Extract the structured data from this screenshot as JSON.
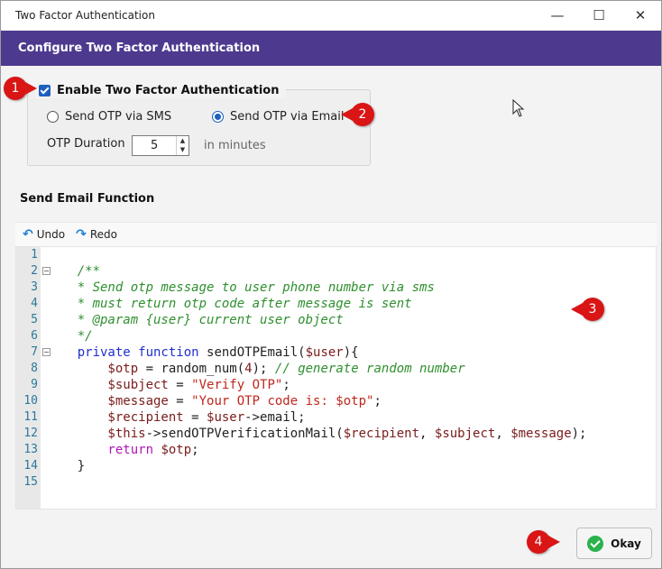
{
  "window": {
    "title": "Two Factor Authentication",
    "controls": {
      "minimize": "—",
      "maximize": "☐",
      "close": "✕"
    }
  },
  "banner": {
    "title": "Configure Two Factor Authentication"
  },
  "settings": {
    "enable_label": "Enable Two Factor Authentication",
    "enable_checked": true,
    "sms_label": "Send OTP via SMS",
    "email_label": "Send OTP via Email",
    "selected": "email",
    "otp_duration_label": "OTP Duration",
    "otp_duration_value": "5",
    "otp_duration_unit": "in minutes"
  },
  "section_title": "Send Email Function",
  "toolbar": {
    "undo_label": "Undo",
    "redo_label": "Redo"
  },
  "editor": {
    "line_numbers": [
      "1",
      "2",
      "3",
      "4",
      "5",
      "6",
      "7",
      "8",
      "9",
      "10",
      "11",
      "12",
      "13",
      "14",
      "15"
    ],
    "lines": [
      {
        "parts": []
      },
      {
        "parts": [
          [
            "cm",
            "    /**"
          ]
        ]
      },
      {
        "parts": [
          [
            "cm",
            "    * Send otp message to user phone number via sms"
          ]
        ]
      },
      {
        "parts": [
          [
            "cm",
            "    * must return otp code after message is sent"
          ]
        ]
      },
      {
        "parts": [
          [
            "cm",
            "    * @param {user} current user object"
          ]
        ]
      },
      {
        "parts": [
          [
            "cm",
            "    */"
          ]
        ]
      },
      {
        "parts": [
          [
            "kw",
            "    private function "
          ],
          [
            "pl",
            "sendOTPEmail("
          ],
          [
            "var",
            "$user"
          ],
          [
            "pl",
            "){"
          ]
        ]
      },
      {
        "parts": [
          [
            "var",
            "        $otp"
          ],
          [
            "pl",
            " = random_num("
          ],
          [
            "var",
            "4"
          ],
          [
            "pl",
            "); "
          ],
          [
            "cm",
            "// generate random number"
          ]
        ]
      },
      {
        "parts": [
          [
            "var",
            "        $subject"
          ],
          [
            "pl",
            " = "
          ],
          [
            "str",
            "\"Verify OTP\""
          ],
          [
            "pl",
            ";"
          ]
        ]
      },
      {
        "parts": [
          [
            "var",
            "        $message"
          ],
          [
            "pl",
            " = "
          ],
          [
            "str",
            "\"Your OTP code is: $otp\""
          ],
          [
            "pl",
            ";"
          ]
        ]
      },
      {
        "parts": [
          [
            "var",
            "        $recipient"
          ],
          [
            "pl",
            " = "
          ],
          [
            "var",
            "$user"
          ],
          [
            "pl",
            "->email;"
          ]
        ]
      },
      {
        "parts": [
          [
            "var",
            "        $this"
          ],
          [
            "pl",
            "->sendOTPVerificationMail("
          ],
          [
            "var",
            "$recipient"
          ],
          [
            "pl",
            ", "
          ],
          [
            "var",
            "$subject"
          ],
          [
            "pl",
            ", "
          ],
          [
            "var",
            "$message"
          ],
          [
            "pl",
            ");"
          ]
        ]
      },
      {
        "parts": [
          [
            "kw2",
            "        return "
          ],
          [
            "var",
            "$otp"
          ],
          [
            "pl",
            ";"
          ]
        ]
      },
      {
        "parts": [
          [
            "pl",
            "    }"
          ]
        ]
      },
      {
        "parts": []
      }
    ]
  },
  "callouts": [
    "1",
    "2",
    "3",
    "4"
  ],
  "okay_button": {
    "label": "Okay"
  },
  "colors": {
    "banner": "#4d3a8f",
    "accent": "#1e5fbf",
    "callout": "#d91515",
    "ok_check": "#2bb24c"
  }
}
